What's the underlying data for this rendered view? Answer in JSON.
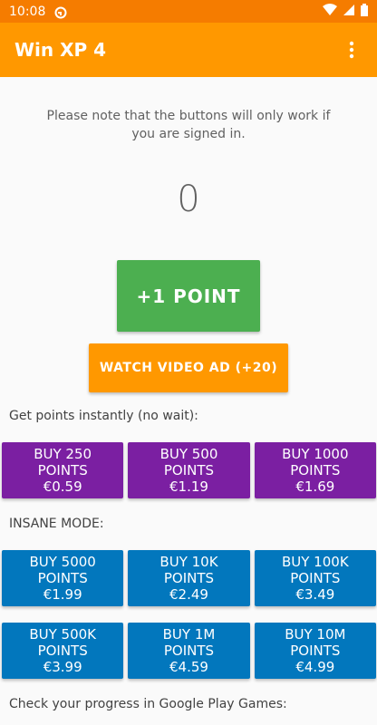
{
  "status_bar": {
    "time": "10:08"
  },
  "app_bar": {
    "title": "Win XP 4"
  },
  "main": {
    "note": "Please note that the buttons will only work if you are signed in.",
    "counter": "0",
    "plus_button": "+1 POINT",
    "ad_button": "WATCH VIDEO AD (+20)",
    "instant_label": "Get points instantly (no wait):",
    "instant_options": [
      {
        "l1": "BUY 250",
        "l2": "POINTS",
        "l3": "€0.59"
      },
      {
        "l1": "BUY 500",
        "l2": "POINTS",
        "l3": "€1.19"
      },
      {
        "l1": "BUY 1000",
        "l2": "POINTS",
        "l3": "€1.69"
      }
    ],
    "insane_label": "INSANE MODE:",
    "insane_row1": [
      {
        "l1": "BUY 5000",
        "l2": "POINTS",
        "l3": "€1.99"
      },
      {
        "l1": "BUY 10K",
        "l2": "POINTS",
        "l3": "€2.49"
      },
      {
        "l1": "BUY 100K",
        "l2": "POINTS",
        "l3": "€3.49"
      }
    ],
    "insane_row2": [
      {
        "l1": "BUY 500K",
        "l2": "POINTS",
        "l3": "€3.99"
      },
      {
        "l1": "BUY 1M",
        "l2": "POINTS",
        "l3": "€4.59"
      },
      {
        "l1": "BUY 10M",
        "l2": "POINTS",
        "l3": "€4.99"
      }
    ],
    "progress_label": "Check your progress in Google Play Games:"
  },
  "colors": {
    "status": "#f57c00",
    "app_bar": "#ff9800",
    "green": "#4caf50",
    "purple": "#7b1fa2",
    "blue": "#0277bd"
  }
}
